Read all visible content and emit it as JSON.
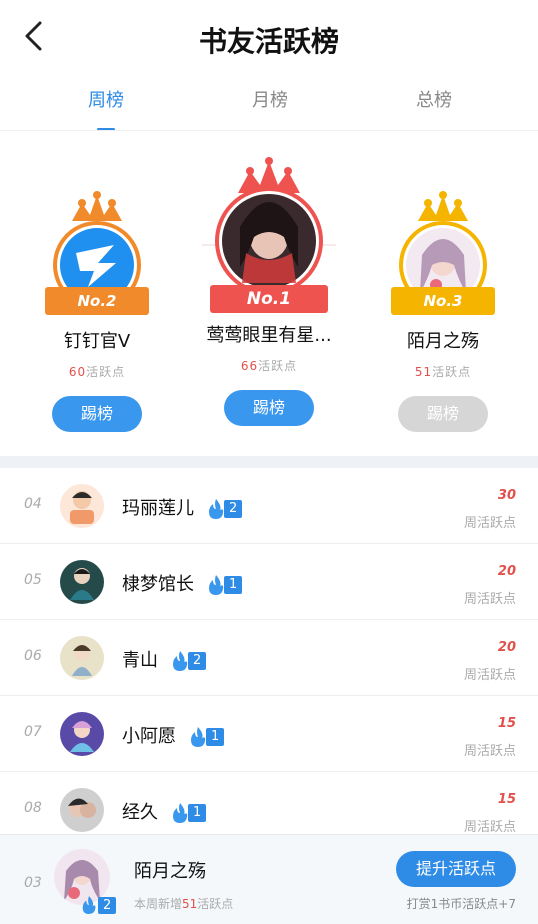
{
  "header": {
    "title": "书友活跃榜"
  },
  "tabs": [
    {
      "label": "周榜",
      "active": true
    },
    {
      "label": "月榜",
      "active": false
    },
    {
      "label": "总榜",
      "active": false
    }
  ],
  "podium": {
    "first": {
      "rank": "No.1",
      "name": "莺莺眼里有星...",
      "points": "66",
      "points_label": "活跃点",
      "button": "踢榜",
      "enabled": true
    },
    "second": {
      "rank": "No.2",
      "name": "钉钉官V",
      "points": "60",
      "points_label": "活跃点",
      "button": "踢榜",
      "enabled": true
    },
    "third": {
      "rank": "No.3",
      "name": "陌月之殇",
      "points": "51",
      "points_label": "活跃点",
      "button": "踢榜",
      "enabled": false
    }
  },
  "list": [
    {
      "rank": "04",
      "name": "玛丽莲儿",
      "level": "2",
      "score": "30",
      "score_label": "周活跃点"
    },
    {
      "rank": "05",
      "name": "棣梦馆长",
      "level": "1",
      "score": "20",
      "score_label": "周活跃点"
    },
    {
      "rank": "06",
      "name": "青山",
      "level": "2",
      "score": "20",
      "score_label": "周活跃点"
    },
    {
      "rank": "07",
      "name": "小阿愿",
      "level": "1",
      "score": "15",
      "score_label": "周活跃点"
    },
    {
      "rank": "08",
      "name": "经久",
      "level": "1",
      "score": "15",
      "score_label": "周活跃点"
    }
  ],
  "me": {
    "rank": "03",
    "name": "陌月之殇",
    "level": "2",
    "weekly_prefix": "本周新增",
    "weekly_points": "51",
    "weekly_suffix": "活跃点",
    "button": "提升活跃点",
    "tip": "打赏1书币活跃点+7"
  },
  "colors": {
    "accent": "#2e8be6",
    "red": "#e2504c",
    "gold": "#f5b400",
    "orange": "#f08a2a",
    "crown_red": "#ee5350"
  }
}
